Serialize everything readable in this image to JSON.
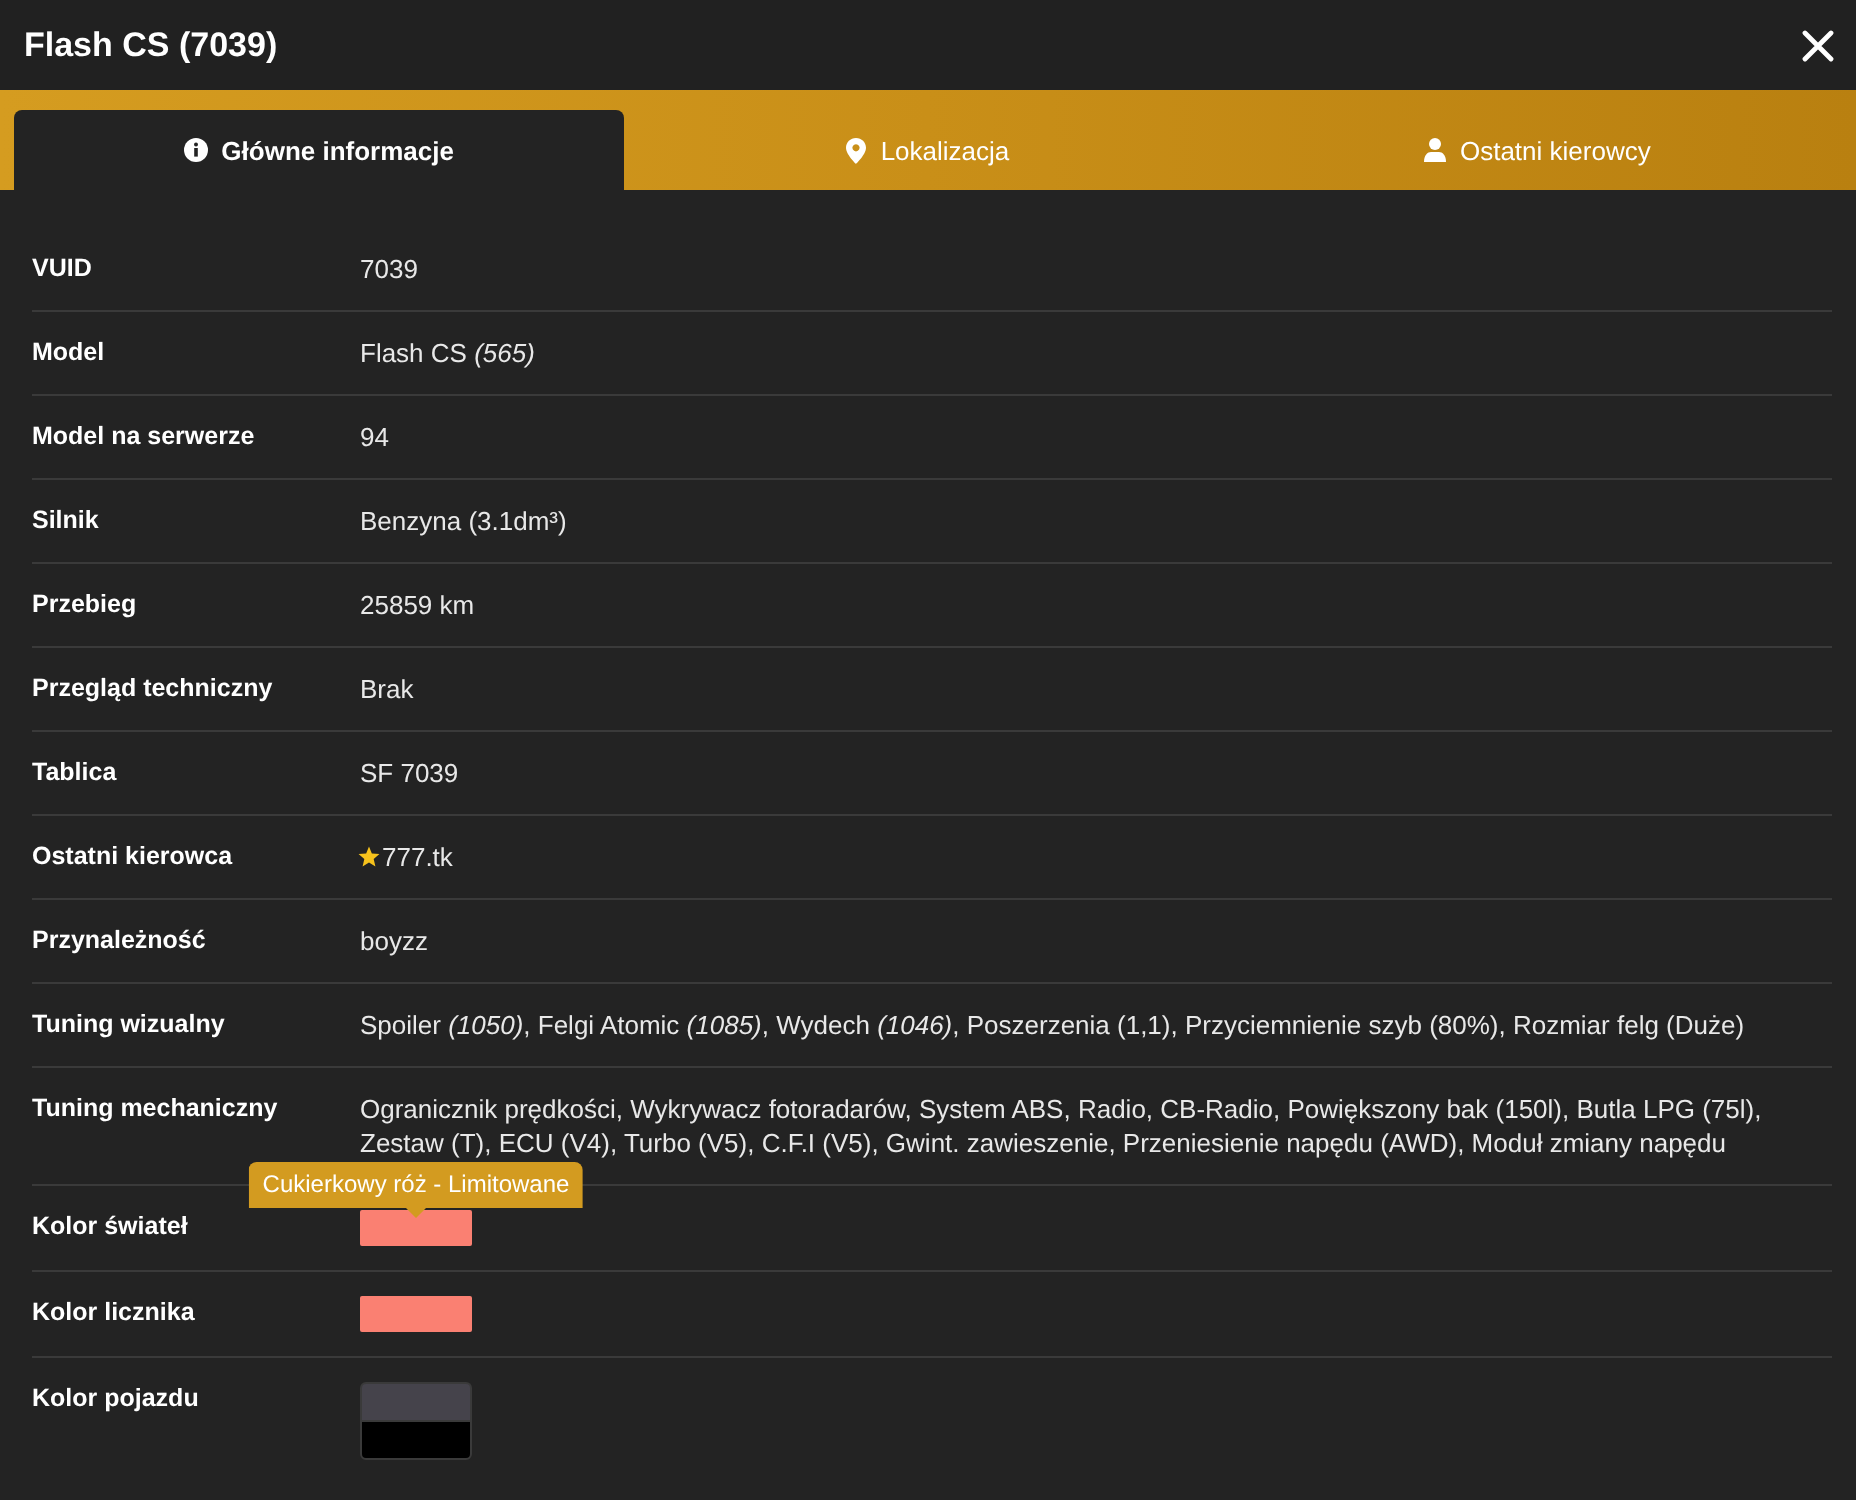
{
  "window": {
    "title": "Flash CS (7039)"
  },
  "tabs": [
    {
      "label": "Główne informacje",
      "selected": true
    },
    {
      "label": "Lokalizacja",
      "selected": false
    },
    {
      "label": "Ostatni kierowcy",
      "selected": false
    }
  ],
  "rows": [
    {
      "kind": "text",
      "label": "VUID",
      "value": "7039"
    },
    {
      "kind": "text",
      "label": "Model",
      "value": "Flash CS *(565)*"
    },
    {
      "kind": "text",
      "label": "Model na serwerze",
      "value": "94"
    },
    {
      "kind": "text",
      "label": "Silnik",
      "value": "Benzyna (3.1dm³)"
    },
    {
      "kind": "text",
      "label": "Przebieg",
      "value": "25859 km"
    },
    {
      "kind": "text",
      "label": "Przegląd techniczny",
      "value": "Brak"
    },
    {
      "kind": "text",
      "label": "Tablica",
      "value": "SF 7039"
    },
    {
      "kind": "driver",
      "label": "Ostatni kierowca",
      "value": "777.tk"
    },
    {
      "kind": "text",
      "label": "Przynależność",
      "value": "boyzz"
    },
    {
      "kind": "text",
      "label": "Tuning wizualny",
      "value": "Spoiler *(1050)*, Felgi Atomic *(1085)*, Wydech *(1046)*, Poszerzenia (1,1), Przyciemnienie szyb (80%), Rozmiar felg (Duże)"
    },
    {
      "kind": "text",
      "label": "Tuning mechaniczny",
      "value": "Ogranicznik prędkości, Wykrywacz fotoradarów, System ABS, Radio, CB-Radio, Powiększony bak (150l), Butla LPG (75l), Zestaw (T), ECU (V4), Turbo (V5), C.F.I (V5), Gwint. zawieszenie, Przeniesienie napędu (AWD), Moduł zmiany napędu"
    },
    {
      "kind": "swatch",
      "label": "Kolor świateł",
      "swatches": [
        {
          "color": "#fa8072"
        }
      ],
      "tooltip": "Cukierkowy róż - Limitowane"
    },
    {
      "kind": "swatch",
      "label": "Kolor licznika",
      "swatches": [
        {
          "color": "#fa8072"
        }
      ]
    },
    {
      "kind": "swatch",
      "label": "Kolor pojazdu",
      "swatches": [
        {
          "color": "#45434b"
        },
        {
          "color": "#000000"
        }
      ]
    }
  ]
}
